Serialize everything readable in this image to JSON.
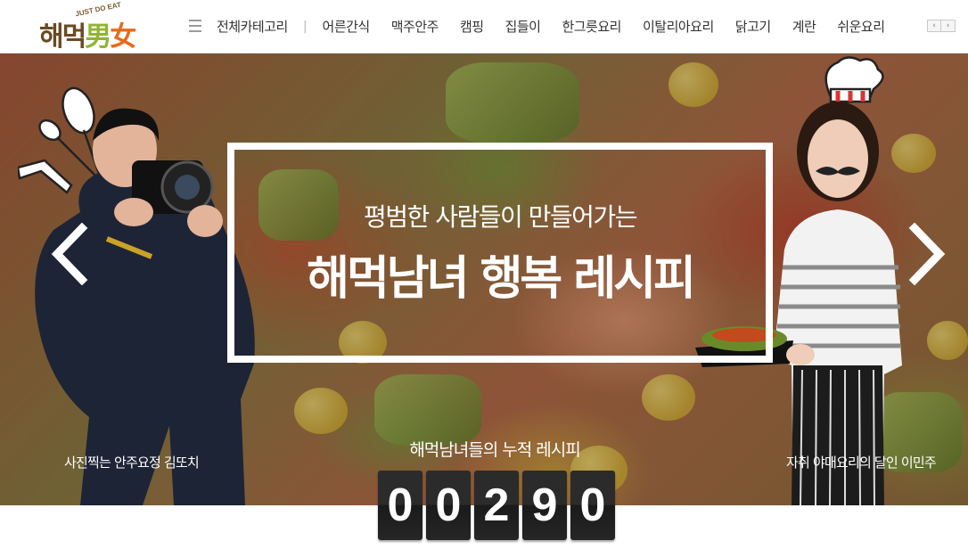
{
  "logo": {
    "tagline": "JUST DO EAT",
    "text_part1": "해먹",
    "text_part2": "男",
    "text_part3": "女"
  },
  "header": {
    "menu_icon": "hamburger-icon",
    "nav": [
      {
        "label": "전체카테고리"
      },
      {
        "label": "어른간식"
      },
      {
        "label": "맥주안주"
      },
      {
        "label": "캠핑"
      },
      {
        "label": "집들이"
      },
      {
        "label": "한그릇요리"
      },
      {
        "label": "이탈리아요리"
      },
      {
        "label": "닭고기"
      },
      {
        "label": "계란"
      },
      {
        "label": "쉬운요리"
      }
    ],
    "separator": "|",
    "prev_arrow": "‹",
    "next_arrow": "›"
  },
  "hero": {
    "subtitle": "평범한 사람들이 만들어가는",
    "title": "해먹남녀 행복 레시피",
    "left_caption": "사진찍는 안주요정 김또치",
    "right_caption": "자취 야매요리의 달인 이민주",
    "counter_label": "해먹남녀들의 누적 레시피",
    "counter_digits": [
      "0",
      "0",
      "2",
      "9",
      "0"
    ],
    "prev_icon": "chevron-left-icon",
    "next_icon": "chevron-right-icon"
  },
  "colors": {
    "logo_brown": "#6b4a22",
    "logo_green": "#8fb634",
    "logo_orange": "#e86a1b",
    "frame": "#ffffff",
    "digit_bg": "#2b2b2b"
  }
}
